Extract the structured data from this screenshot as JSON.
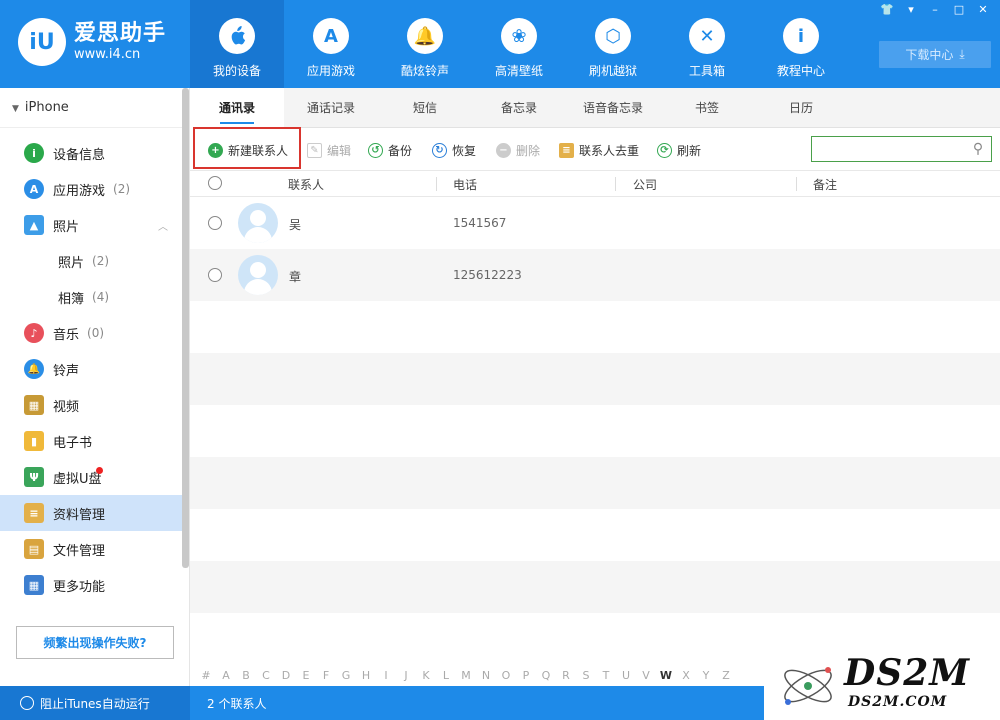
{
  "app": {
    "name": "爱思助手",
    "url": "www.i4.cn",
    "logo_mark": "iU"
  },
  "nav": [
    {
      "label": "我的设备",
      "glyph": ""
    },
    {
      "label": "应用游戏",
      "glyph": "A"
    },
    {
      "label": "酷炫铃声",
      "glyph": "🔔"
    },
    {
      "label": "高清壁纸",
      "glyph": "❀"
    },
    {
      "label": "刷机越狱",
      "glyph": "⬡"
    },
    {
      "label": "工具箱",
      "glyph": "✕"
    },
    {
      "label": "教程中心",
      "glyph": "i"
    }
  ],
  "download_center": "下载中心",
  "window_controls": [
    "👕",
    "▾",
    "–",
    "□",
    "✕"
  ],
  "device": "iPhone",
  "sidebar": [
    {
      "label": "设备信息",
      "count": "",
      "glyph": "i",
      "color": "#2aa84a"
    },
    {
      "label": "应用游戏",
      "count": "(2)",
      "glyph": "A",
      "color": "#2b8ee6"
    },
    {
      "label": "照片",
      "count": "",
      "glyph": "▲",
      "color": "#3d9de8"
    },
    {
      "label": "照片",
      "count": "(2)"
    },
    {
      "label": "相簿",
      "count": "(4)"
    },
    {
      "label": "音乐",
      "count": "(0)",
      "glyph": "♪",
      "color": "#e8505b"
    },
    {
      "label": "铃声",
      "count": "",
      "glyph": "🔔",
      "color": "#2b8ee6"
    },
    {
      "label": "视频",
      "count": "",
      "glyph": "▦",
      "color": "#c79a36"
    },
    {
      "label": "电子书",
      "count": "",
      "glyph": "▮",
      "color": "#f0b93a"
    },
    {
      "label": "虚拟U盘",
      "count": "",
      "glyph": "Ψ",
      "color": "#3aa55a"
    },
    {
      "label": "资料管理",
      "count": "",
      "glyph": "≡",
      "color": "#e3b04a"
    },
    {
      "label": "文件管理",
      "count": "",
      "glyph": "▤",
      "color": "#d9a43e"
    },
    {
      "label": "更多功能",
      "count": "",
      "glyph": "▦",
      "color": "#3d7fd0"
    }
  ],
  "fail_button": "频繁出现操作失败?",
  "tabs": [
    "通讯录",
    "通话记录",
    "短信",
    "备忘录",
    "语音备忘录",
    "书签",
    "日历"
  ],
  "toolbar": {
    "new_contact": "新建联系人",
    "edit": "编辑",
    "backup": "备份",
    "restore": "恢复",
    "delete": "删除",
    "dedupe": "联系人去重",
    "refresh": "刷新"
  },
  "search": {
    "placeholder": ""
  },
  "columns": [
    "联系人",
    "电话",
    "公司",
    "备注"
  ],
  "contacts": [
    {
      "name": "吴",
      "phone": "1541567",
      "company": "",
      "note": ""
    },
    {
      "name": "章",
      "phone": "125612223",
      "company": "",
      "note": ""
    }
  ],
  "alphabet": [
    "#",
    "A",
    "B",
    "C",
    "D",
    "E",
    "F",
    "G",
    "H",
    "I",
    "J",
    "K",
    "L",
    "M",
    "N",
    "O",
    "P",
    "Q",
    "R",
    "S",
    "T",
    "U",
    "V",
    "W",
    "X",
    "Y",
    "Z"
  ],
  "alphabet_active": "W",
  "status": {
    "itunes_block": "阻止iTunes自动运行",
    "contact_count": "2 个联系人"
  },
  "watermark": {
    "big": "DS2M",
    "small": "DS2M.COM"
  },
  "colors": {
    "primary": "#1e8ae8",
    "highlight": "#d9352e"
  }
}
